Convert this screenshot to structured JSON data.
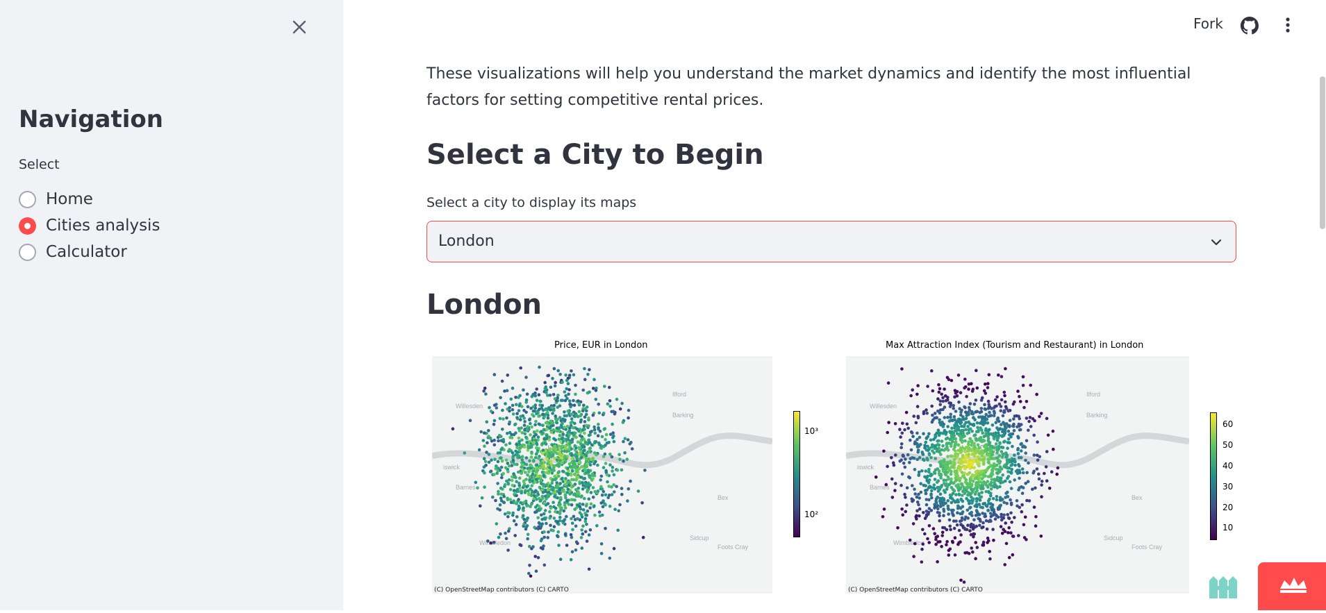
{
  "sidebar": {
    "title": "Navigation",
    "radio_label": "Select",
    "options": [
      {
        "label": "Home",
        "checked": false
      },
      {
        "label": "Cities analysis",
        "checked": true
      },
      {
        "label": "Calculator",
        "checked": false
      }
    ],
    "close_icon": "close-icon"
  },
  "header": {
    "fork_label": "Fork",
    "github_icon": "github-icon",
    "menu_icon": "more-vert-icon"
  },
  "main": {
    "intro": "These visualizations will help you understand the market dynamics and identify the most influential factors for setting competitive rental prices.",
    "heading": "Select a City to Begin",
    "select_label": "Select a city to display its maps",
    "select_value": "London",
    "city_heading": "London"
  },
  "maps": [
    {
      "title": "Price, EUR in London",
      "credit": "(C) OpenStreetMap contributors (C) CARTO",
      "colorbar_ticks": [
        "10³",
        "10²"
      ],
      "scale": "log",
      "places": [
        "Willesden",
        "Ilford",
        "Barking",
        "Barnes",
        "Wimbledon",
        "Sidcup",
        "Foots Cray",
        "iswick",
        "Bex",
        "LONDON"
      ]
    },
    {
      "title": "Max Attraction Index (Tourism and Restaurant) in London",
      "credit": "(C) OpenStreetMap contributors (C) CARTO",
      "colorbar_ticks": [
        "60",
        "50",
        "40",
        "30",
        "20",
        "10"
      ],
      "scale": "linear",
      "places": [
        "Willesden",
        "Ilford",
        "Barking",
        "Barnes",
        "Wimbledon",
        "Sidcup",
        "Foots Cray",
        "iswick",
        "Bex",
        "LONDON"
      ]
    }
  ],
  "colors": {
    "accent": "#ff4b4b",
    "sidebar_bg": "#f0f2f6",
    "text": "#31333f"
  }
}
